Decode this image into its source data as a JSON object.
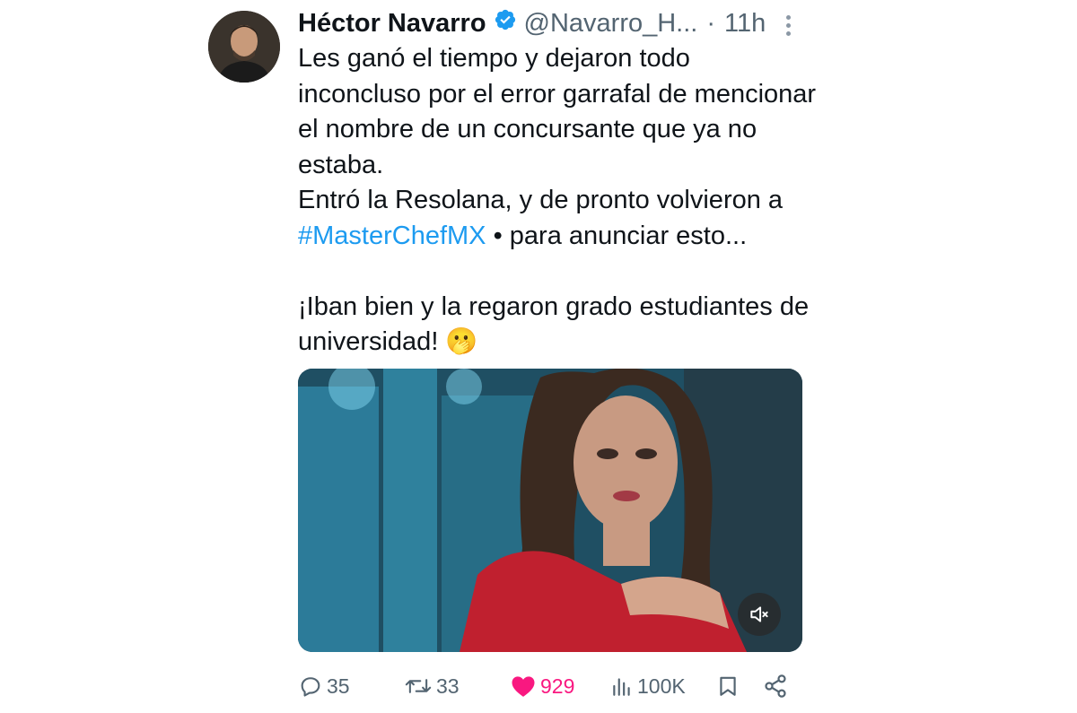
{
  "tweet": {
    "author": {
      "name": "Héctor Navarro",
      "handle": "@Navarro_H...",
      "time": "11h",
      "verified": true,
      "separator": "·"
    },
    "text": {
      "line1": "Les ganó el tiempo y dejaron todo inconcluso por el error garrafal de mencionar el nombre de un concursante que ya no estaba.",
      "line2_prefix": "Entró la Resolana, y de pronto volvieron a ",
      "hashtag": "#MasterChefMX",
      "line2_suffix": " • para anunciar esto...",
      "line3": "¡Iban bien y la regaron grado estudiantes de universidad! 🫢"
    },
    "media": {
      "type": "video",
      "muted": true,
      "icon": "speaker-muted-icon"
    },
    "stats": {
      "replies": "35",
      "retweets": "33",
      "likes": "929",
      "views": "100K"
    },
    "colors": {
      "accent": "#1d9bf0",
      "like": "#f91880",
      "muted_text": "#536471",
      "text": "#0f1419"
    }
  }
}
